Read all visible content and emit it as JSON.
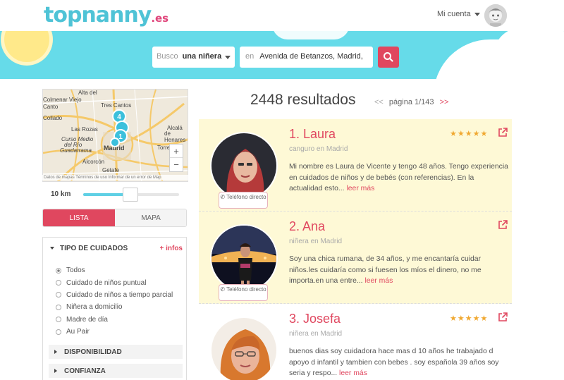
{
  "header": {
    "logo_main": "topnanny",
    "logo_suffix": ".es",
    "account_label": "Mi cuenta"
  },
  "search": {
    "what_label": "Busco",
    "what_value": "una niñera",
    "where_label": "en",
    "where_value": "Avenida de Betanzos, Madrid, Esp"
  },
  "map": {
    "pins": [
      "4",
      "1"
    ],
    "labels": [
      "Alta del",
      "Tres Cantos",
      "Las Rozas",
      "Madrid",
      "Alcorcón",
      "Getafe",
      "Alcalá",
      "de Henares",
      "Torrejón",
      "Curso Medio",
      "del Río",
      "Guadarrama",
      "Colmenar Viejo",
      "Canto",
      "Collado"
    ],
    "zoom_in": "+",
    "zoom_out": "−",
    "footer": "Datos de mapas   Términos de uso   Informar de un error de Map"
  },
  "radius": {
    "label": "10 km",
    "level_pct": 45
  },
  "view_tabs": {
    "list": "LISTA",
    "map": "MAPA"
  },
  "filters": {
    "care_type": {
      "title": "TIPO DE CUIDADOS",
      "more": "+ infos",
      "options": [
        "Todos",
        "Cuidado de niños puntual",
        "Cuidado de niños a tiempo parcial",
        "Niñera a domicilio",
        "Madre de día",
        "Au Pair"
      ],
      "selected_index": 0
    },
    "sections": [
      "DISPONIBILIDAD",
      "CONFIANZA"
    ]
  },
  "results": {
    "count": "2448 resultados",
    "prev": "<<",
    "page": "página 1/143",
    "next": ">>",
    "items": [
      {
        "name": "1. Laura",
        "role": "canguro en Madrid",
        "desc": "Mi nombre es Laura de Vicente y tengo 48 años. Tengo experiencia en cuidados de niños y de bebés (con referencias). En la actualidad esto...",
        "more": "leer más",
        "phone": "Teléfono directo",
        "stars": "★★★★★",
        "highlight": true
      },
      {
        "name": "2. Ana",
        "role": "niñera en Madrid",
        "desc": "Soy una chica rumana, de 34 años, y me encantaría cuidar niños.les cuidaría como si fuesen los míos el dinero, no me importa.en una entre...",
        "more": "leer más",
        "phone": "Teléfono directo",
        "stars": "",
        "highlight": true
      },
      {
        "name": "3. Josefa",
        "role": "niñera en Madrid",
        "desc": "buenos dias soy cuidadora hace mas d 10 años he trabajado d apoyo d infantil y tambien con bebes . soy española 39 años soy seria y respo...",
        "more": "leer más",
        "phone": "",
        "stars": "★★★★★",
        "highlight": false
      }
    ]
  },
  "colors": {
    "accent": "#e0475f",
    "brand_teal": "#4fc3d6",
    "banner": "#66dbe9",
    "highlight": "#fef9d6",
    "star": "#f0a830"
  }
}
